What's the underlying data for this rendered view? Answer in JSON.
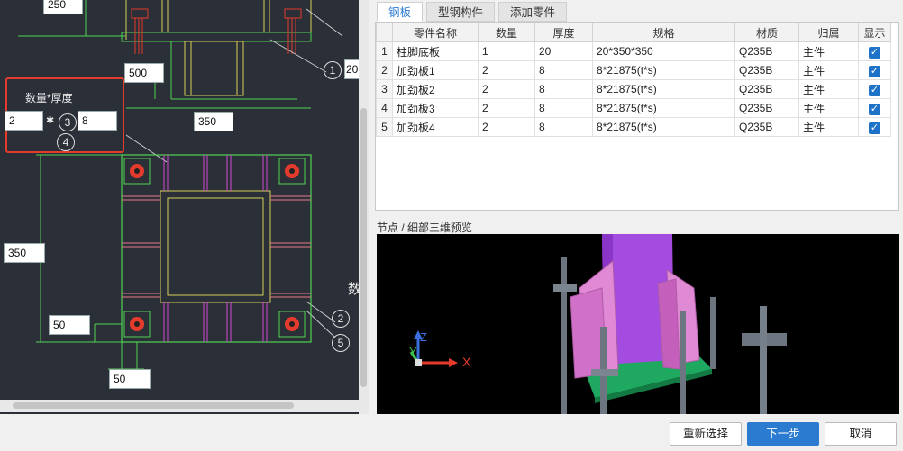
{
  "drawing": {
    "dims": {
      "top_left": "250",
      "dim_500": "500",
      "dim_350_top": "350",
      "dim_350_left": "350",
      "dim_50_a": "50",
      "dim_50_b": "50",
      "cut_20": "20"
    },
    "qty_thickness": {
      "label": "数量*厚度",
      "qty_value": "2",
      "times": "✱",
      "thickness_value": "8",
      "circle_3": "3",
      "circle_4": "4"
    },
    "callouts": {
      "c1": "1",
      "c2": "2",
      "c5": "5"
    },
    "partial_text": "数"
  },
  "tabs": [
    {
      "label": "钢板",
      "active": true
    },
    {
      "label": "型钢构件",
      "active": false
    },
    {
      "label": "添加零件",
      "active": false
    }
  ],
  "table": {
    "headers": [
      "",
      "零件名称",
      "数量",
      "厚度",
      "规格",
      "材质",
      "归属",
      "显示"
    ],
    "rows": [
      {
        "no": "1",
        "name": "柱脚底板",
        "qty": "1",
        "thick": "20",
        "spec": "20*350*350",
        "material": "Q235B",
        "owner": "主件",
        "show": true
      },
      {
        "no": "2",
        "name": "加劲板1",
        "qty": "2",
        "thick": "8",
        "spec": "8*21875(t*s)",
        "material": "Q235B",
        "owner": "主件",
        "show": true
      },
      {
        "no": "3",
        "name": "加劲板2",
        "qty": "2",
        "thick": "8",
        "spec": "8*21875(t*s)",
        "material": "Q235B",
        "owner": "主件",
        "show": true
      },
      {
        "no": "4",
        "name": "加劲板3",
        "qty": "2",
        "thick": "8",
        "spec": "8*21875(t*s)",
        "material": "Q235B",
        "owner": "主件",
        "show": true
      },
      {
        "no": "5",
        "name": "加劲板4",
        "qty": "2",
        "thick": "8",
        "spec": "8*21875(t*s)",
        "material": "Q235B",
        "owner": "主件",
        "show": true
      }
    ]
  },
  "preview": {
    "title": "节点 / 细部三维预览",
    "axis_x": "X",
    "axis_y": "Y",
    "axis_z": "Z"
  },
  "buttons": {
    "reselect": "重新选择",
    "next": "下一步",
    "cancel": "取消"
  },
  "colors": {
    "accent": "#2b7bd1",
    "highlight_border": "#e53b2c",
    "cad_background": "#2b2f38"
  }
}
